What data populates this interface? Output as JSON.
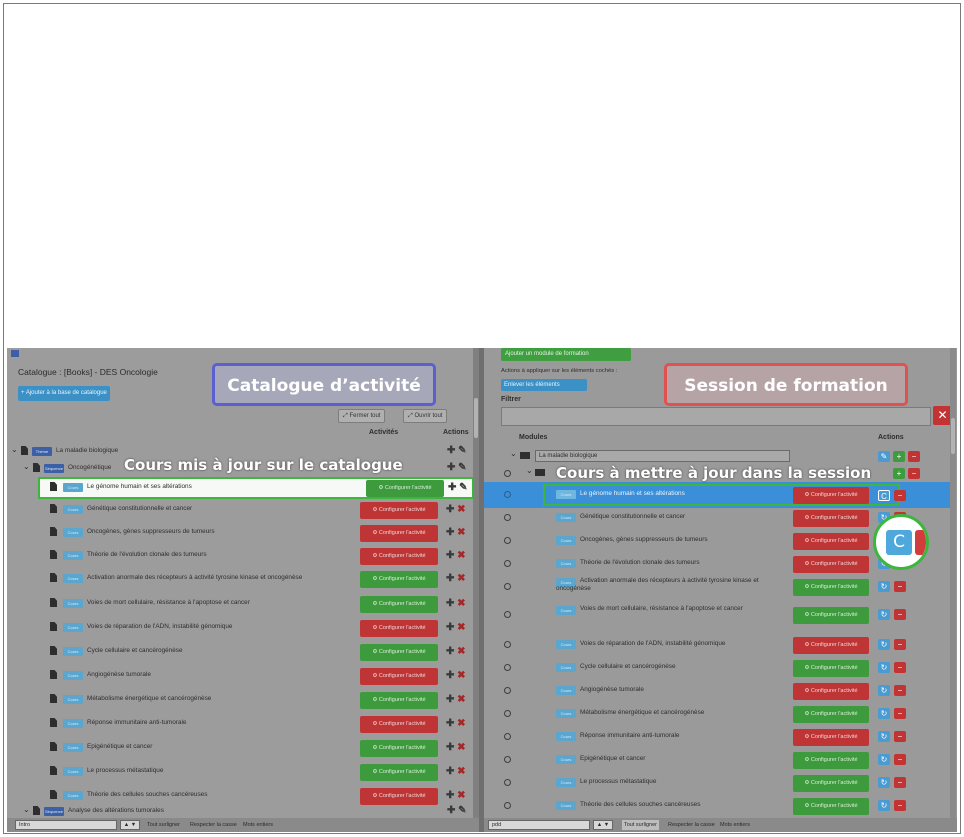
{
  "overlays": {
    "catalog_title": "Catalogue d’activité",
    "session_title": "Session de formation",
    "catalog_caption": "Cours mis à jour sur le catalogue",
    "session_caption": "Cours à mettre à jour dans la session",
    "zoom_button_letter": "C"
  },
  "left": {
    "page_title": "Catalogue : [Books] - DES Oncologie",
    "add_button": "+ Ajouter à la base de catalogue",
    "collapse_button": "⤢ Fermer tout",
    "expand_button": "⤢ Ouvrir tout",
    "col_activities": "Activités",
    "col_actions": "Actions",
    "theme_tag": "Thème",
    "theme_label": "La maladie biologique",
    "seq_tag": "Séquence",
    "seq_label": "Oncogénétique",
    "course_tag": "Cours",
    "configure_label": "⚙ Configurer l'activité",
    "rows": [
      {
        "label": "Le génome humain et ses altérations",
        "state": "green"
      },
      {
        "label": "Génétique constitutionnelle et cancer",
        "state": "red"
      },
      {
        "label": "Oncogènes, gènes suppresseurs de tumeurs",
        "state": "red"
      },
      {
        "label": "Théorie de l'évolution clonale des tumeurs",
        "state": "red"
      },
      {
        "label": "Activation anormale des récepteurs à activité tyrosine kinase et oncogénèse",
        "state": "green"
      },
      {
        "label": "Voies de mort cellulaire, résistance à l'apoptose et cancer",
        "state": "green"
      },
      {
        "label": "Voies de réparation de l'ADN, instabilité génomique",
        "state": "red"
      },
      {
        "label": "Cycle cellulaire et cancérogénèse",
        "state": "green"
      },
      {
        "label": "Angiogénèse tumorale",
        "state": "red"
      },
      {
        "label": "Métabolisme énergétique et cancérogénèse",
        "state": "green"
      },
      {
        "label": "Réponse immunitaire anti-tumorale",
        "state": "red"
      },
      {
        "label": "Epigénétique et cancer",
        "state": "green"
      },
      {
        "label": "Le processus métastatique",
        "state": "green"
      },
      {
        "label": "Théorie des cellules souches cancéreuses",
        "state": "red"
      }
    ],
    "last_seq_label": "Analyse des altérations tumorales",
    "status_input": "Intro",
    "status_links": [
      "Tout surligner",
      "Respecter la casse",
      "Mots entiers"
    ]
  },
  "right": {
    "add_module_button": "Ajouter un module de formation",
    "actions_label": "Actions à appliquer sur les éléments cochés :",
    "delete_button": "Enlever les éléments",
    "filter_label": "Filtrer",
    "col_modules": "Modules",
    "col_actions": "Actions",
    "theme_label": "La maladie biologique",
    "course_tag": "Cours",
    "configure_label": "⚙ Configurer l'activité",
    "rows": [
      {
        "label": "Le génome humain et ses altérations",
        "state": "red"
      },
      {
        "label": "Génétique constitutionnelle et cancer",
        "state": "red"
      },
      {
        "label": "Oncogènes, gènes suppresseurs de tumeurs",
        "state": "red"
      },
      {
        "label": "Théorie de l'évolution clonale des tumeurs",
        "state": "red"
      },
      {
        "label": "Activation anormale des récepteurs à activité tyrosine kinase et oncogénèse",
        "state": "green"
      },
      {
        "label": "Voies de mort cellulaire, résistance à l'apoptose et cancer",
        "state": "green"
      },
      {
        "label": "Voies de réparation de l'ADN, instabilité génomique",
        "state": "red"
      },
      {
        "label": "Cycle cellulaire et cancérogénèse",
        "state": "green"
      },
      {
        "label": "Angiogénèse tumorale",
        "state": "red"
      },
      {
        "label": "Métabolisme énergétique et cancérogénèse",
        "state": "green"
      },
      {
        "label": "Réponse immunitaire anti-tumorale",
        "state": "red"
      },
      {
        "label": "Epigénétique et cancer",
        "state": "green"
      },
      {
        "label": "Le processus métastatique",
        "state": "green"
      },
      {
        "label": "Théorie des cellules souches cancéreuses",
        "state": "green"
      }
    ],
    "status_input": "pdd",
    "status_links": [
      "Tout surligner",
      "Respecter la casse",
      "Mots entiers"
    ]
  },
  "colors": {
    "catalog_box": "#5a5fd1",
    "session_box": "#e0524f",
    "highlight_green": "#3db63d",
    "selected_row": "#3b8fd8"
  }
}
